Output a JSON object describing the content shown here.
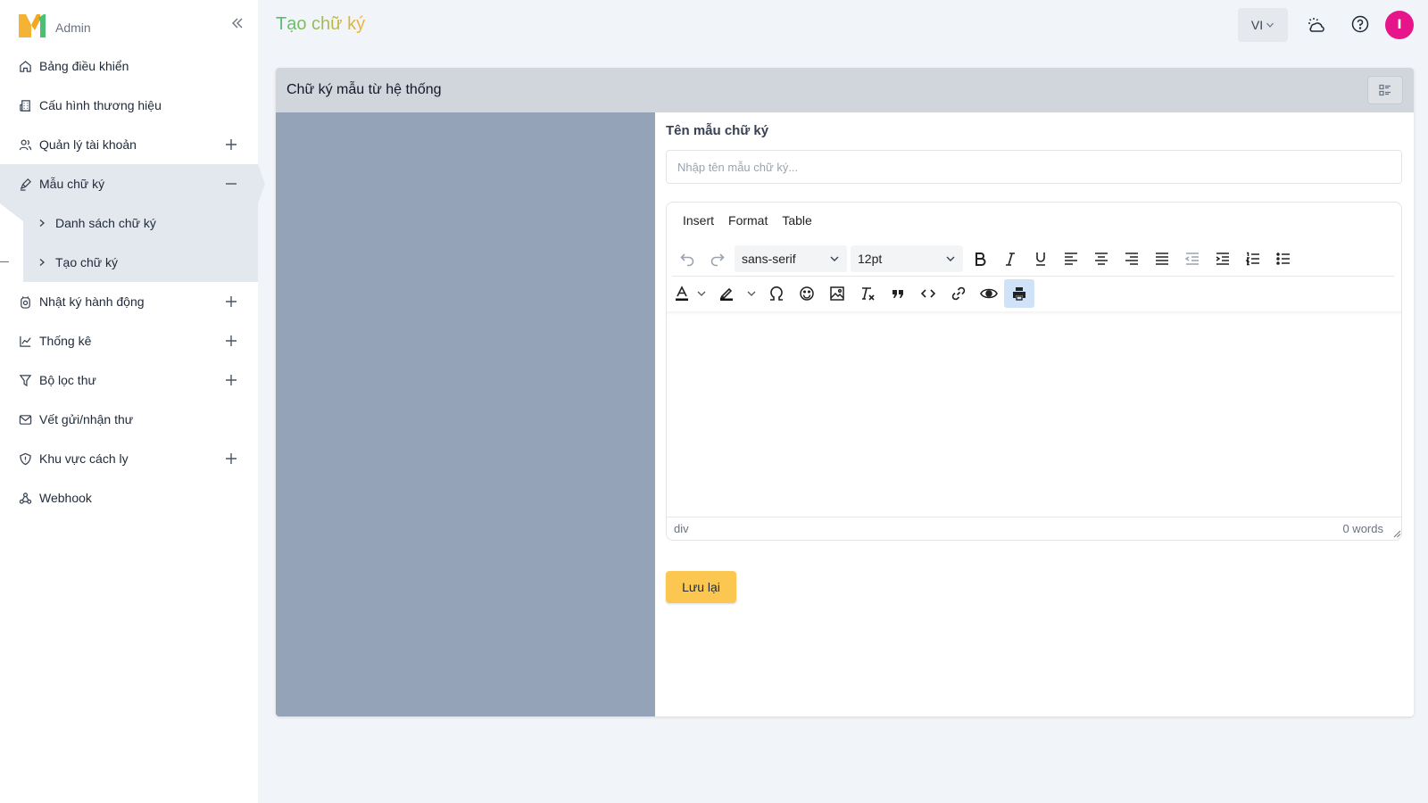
{
  "brand": {
    "logo_text": "M1",
    "subtitle": "Admin"
  },
  "header": {
    "page_title": "Tạo chữ ký",
    "language": "VI",
    "avatar_initial": "I"
  },
  "sidebar": {
    "items": [
      {
        "label": "Bảng điều khiển",
        "icon": "home-icon"
      },
      {
        "label": "Cấu hình thương hiệu",
        "icon": "building-icon"
      },
      {
        "label": "Quản lý tài khoản",
        "icon": "users-icon",
        "expand": "plus"
      },
      {
        "label": "Mẫu chữ ký",
        "icon": "signature-icon",
        "expand": "minus",
        "active": true
      },
      {
        "label": "Nhật ký hành động",
        "icon": "history-icon",
        "expand": "plus"
      },
      {
        "label": "Thống kê",
        "icon": "chart-icon",
        "expand": "plus"
      },
      {
        "label": "Bộ lọc thư",
        "icon": "filter-icon",
        "expand": "plus"
      },
      {
        "label": "Vết gửi/nhận thư",
        "icon": "mail-icon"
      },
      {
        "label": "Khu vực cách ly",
        "icon": "shield-icon",
        "expand": "plus"
      },
      {
        "label": "Webhook",
        "icon": "webhook-icon"
      }
    ],
    "sub_items": [
      {
        "label": "Danh sách chữ ký"
      },
      {
        "label": "Tạo chữ ký",
        "current": true
      }
    ]
  },
  "card": {
    "title": "Chữ ký mẫu từ hệ thống",
    "field_label": "Tên mẫu chữ ký",
    "field_placeholder": "Nhập tên mẫu chữ ký...",
    "save_label": "Lưu lại"
  },
  "editor": {
    "menus": [
      "Insert",
      "Format",
      "Table"
    ],
    "font_family": "sans-serif",
    "font_size": "12pt",
    "status_path": "div",
    "word_count": "0 words"
  },
  "colors": {
    "accent_yellow": "#fbc751",
    "active_bg": "#e3e8ef",
    "preview_bg": "#94a3b8",
    "avatar": "#e6168a"
  }
}
